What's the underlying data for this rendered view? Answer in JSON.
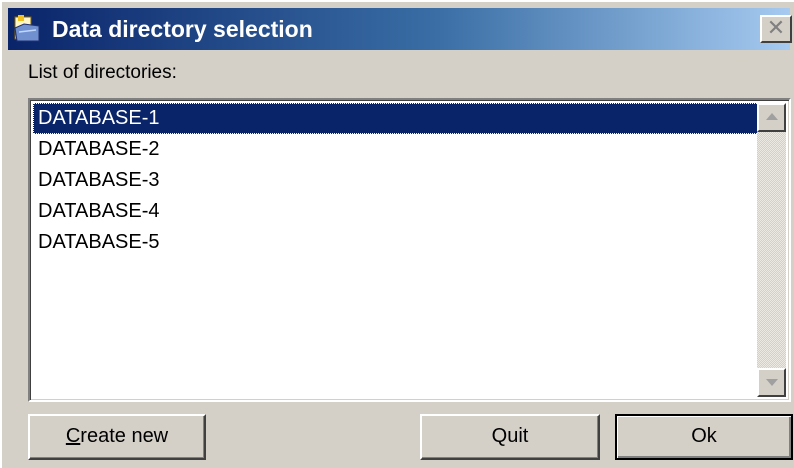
{
  "window": {
    "title": "Data directory selection",
    "close_glyph": "✕"
  },
  "list": {
    "label": "List of directories:",
    "items": [
      "DATABASE-1",
      "DATABASE-2",
      "DATABASE-3",
      "DATABASE-4",
      "DATABASE-5"
    ],
    "selected_index": 0
  },
  "buttons": {
    "create_new": "Create new",
    "quit": "Quit",
    "ok": "Ok"
  },
  "icons": {
    "title": "app-folder-icon",
    "scroll_up": "scroll-up-arrow-icon",
    "scroll_down": "scroll-down-arrow-icon"
  },
  "colors": {
    "title_start": "#0a246a",
    "title_end": "#a6caf0",
    "selection": "#0a246a",
    "face": "#d4d0c8"
  }
}
